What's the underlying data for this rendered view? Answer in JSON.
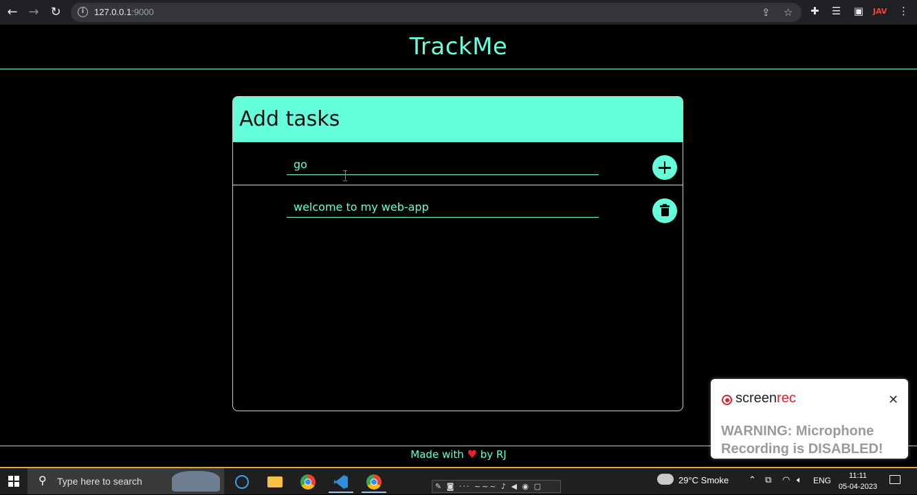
{
  "browser": {
    "url_host": "127.0.0.1",
    "url_port": ":9000",
    "extension_badge": "JAV"
  },
  "app": {
    "title": "TrackMe"
  },
  "card": {
    "title": "Add tasks",
    "new_task_value": "go",
    "tasks": [
      {
        "text": "welcome to my web-app"
      }
    ]
  },
  "footer": {
    "made_with": "Made with",
    "heart": "♥",
    "by": "by RJ"
  },
  "toast": {
    "brand_main": "screen",
    "brand_accent": "rec",
    "message": "WARNING: Microphone Recording is DISABLED!"
  },
  "taskbar": {
    "search_placeholder": "Type here to search",
    "weather": "29°C  Smoke",
    "lang": "ENG",
    "time": "11:11",
    "date": "05-04-2023"
  },
  "colors": {
    "accent": "#64ffda",
    "background": "#000000",
    "heart": "#e8232f",
    "screenrec_red": "#e0202a"
  }
}
